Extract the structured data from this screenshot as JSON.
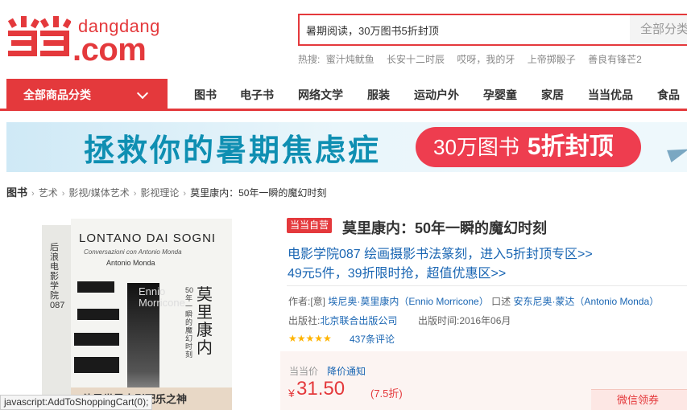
{
  "header": {
    "logo_mark": "当当",
    "logo_small": "dangdang",
    "logo_big": ".com"
  },
  "search": {
    "value": "暑期阅读，30万图书5折封顶",
    "category": "全部分类",
    "hot_label": "热搜:",
    "hot_terms": [
      "蜜汁炖鱿鱼",
      "长安十二时辰",
      "哎呀，我的牙",
      "上帝掷骰子",
      "善良有锋芒2"
    ]
  },
  "nav": {
    "all_categories": "全部商品分类",
    "items": [
      "图书",
      "电子书",
      "网络文学",
      "服装",
      "运动户外",
      "孕婴童",
      "家居",
      "当当优品",
      "食品"
    ]
  },
  "banner": {
    "headline": "拯救你的暑期焦虑症",
    "pill_part1": "30万图书",
    "pill_part2": "5折封顶"
  },
  "breadcrumb": [
    "图书",
    "艺术",
    "影视/媒体艺术",
    "影视理论",
    "莫里康内：50年一瞬的魔幻时刻"
  ],
  "cover": {
    "title": "LONTANO DAI SOGNI",
    "subtitle": "Conversazioni con Antonio Monda",
    "author": "Antonio Monda",
    "vertical_en": "Ennio Morricone",
    "title_cn": "莫里康内",
    "subtitle_cn": "50年一瞬的魔幻时刻",
    "spine": "后浪电影学院087",
    "band_text": "他是世界电影配乐之神"
  },
  "status_bar": "javascript:AddToShoppingCart(0);",
  "product": {
    "badge": "当当自营",
    "title": "莫里康内：50年一瞬的魔幻时刻",
    "promo_prefix": "电影学院087",
    "promo_link1": "绘画摄影书法篆刻，进入5折封顶专区>>",
    "promo_link2": "49元5件，39折限时抢，超值优惠区>>",
    "author_label": "作者:",
    "author_prefix": "[意]",
    "author_name": "埃尼奥·莫里康内（Ennio Morricone）",
    "author_role": "口述",
    "author2_name": "安东尼奥·蒙达（Antonio Monda）",
    "publisher_label": "出版社:",
    "publisher": "北京联合出版公司",
    "date_label": "出版时间:",
    "date": "2016年06月",
    "stars_display": "★★★★★",
    "rating": 5,
    "reviews_count": "437",
    "reviews_suffix": "条评论",
    "price_label": "当当价",
    "price_notice": "降价通知",
    "currency": "¥",
    "price": "31.50",
    "discount": "(7.5折)",
    "coupon": "微信领券"
  },
  "colors": {
    "brand_red": "#e4393c",
    "link_blue": "#1a66b3",
    "banner_teal": "#0f8fb2"
  }
}
